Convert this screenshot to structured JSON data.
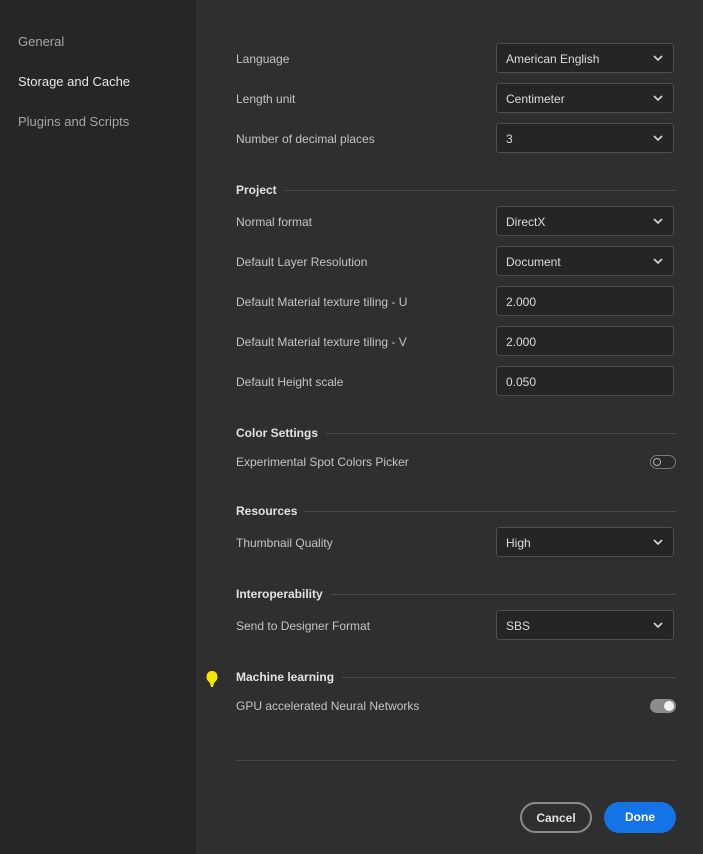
{
  "sidebar": {
    "items": [
      {
        "label": "General",
        "active": false
      },
      {
        "label": "Storage and Cache",
        "active": true
      },
      {
        "label": "Plugins and Scripts",
        "active": false
      }
    ]
  },
  "general": {
    "language": {
      "label": "Language",
      "value": "American English"
    },
    "length_unit": {
      "label": "Length unit",
      "value": "Centimeter"
    },
    "decimal_places": {
      "label": "Number of decimal places",
      "value": "3"
    }
  },
  "project": {
    "title": "Project",
    "normal_format": {
      "label": "Normal format",
      "value": "DirectX"
    },
    "layer_resolution": {
      "label": "Default Layer Resolution",
      "value": "Document"
    },
    "tiling_u": {
      "label": "Default Material texture tiling - U",
      "value": "2.000"
    },
    "tiling_v": {
      "label": "Default Material texture tiling - V",
      "value": "2.000"
    },
    "height_scale": {
      "label": "Default Height scale",
      "value": "0.050"
    }
  },
  "color_settings": {
    "title": "Color Settings",
    "spot_colors": {
      "label": "Experimental Spot Colors Picker",
      "enabled": false
    }
  },
  "resources": {
    "title": "Resources",
    "thumbnail_quality": {
      "label": "Thumbnail Quality",
      "value": "High"
    }
  },
  "interoperability": {
    "title": "Interoperability",
    "designer_format": {
      "label": "Send to Designer Format",
      "value": "SBS"
    }
  },
  "machine_learning": {
    "title": "Machine learning",
    "gpu_networks": {
      "label": "GPU accelerated Neural Networks",
      "enabled": true
    }
  },
  "footer": {
    "cancel_label": "Cancel",
    "done_label": "Done"
  },
  "colors": {
    "accent": "#1473e6",
    "marker": "#f5e600"
  }
}
